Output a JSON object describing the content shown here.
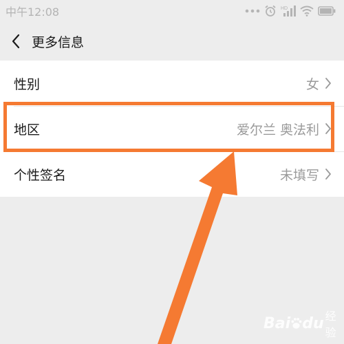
{
  "status_bar": {
    "time": "中午12:08",
    "icons": [
      "dots-icon",
      "alarm-icon",
      "hd-signal-icon",
      "wifi-icon",
      "battery-icon"
    ]
  },
  "nav": {
    "title": "更多信息",
    "back_icon": "chevron-left-icon"
  },
  "rows": [
    {
      "label": "性别",
      "value": "女"
    },
    {
      "label": "地区",
      "value": "爱尔兰 奥法利"
    },
    {
      "label": "个性签名",
      "value": "未填写"
    }
  ],
  "highlight_color": "#f57a32",
  "watermark": {
    "part_a": "Bai",
    "part_b": "du",
    "part_c": "经验"
  }
}
